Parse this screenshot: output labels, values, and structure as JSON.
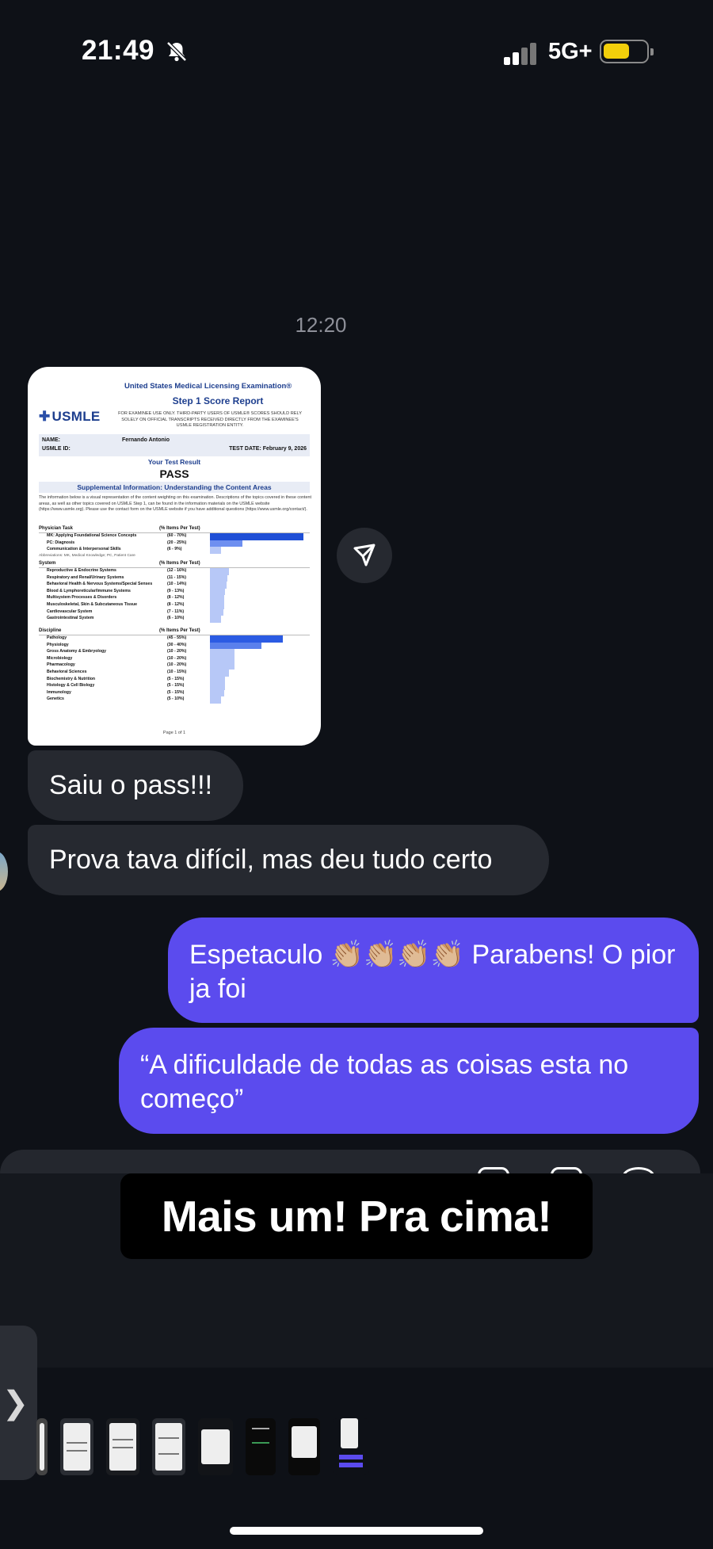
{
  "status_bar": {
    "time": "21:49",
    "network": "5G+",
    "battery_color": "#f2cf0b",
    "bell_icon": "bell-slash-icon"
  },
  "chat": {
    "timestamp": "12:20",
    "doc": {
      "header_line1": "United States Medical Licensing Examination®",
      "header_line2": "Step 1 Score Report",
      "logo": "USMLE",
      "disclaimer": "FOR EXAMINEE USE ONLY. THIRD-PARTY USERS OF USMLE® SCORES SHOULD RELY SOLELY ON OFFICIAL TRANSCRIPTS RECEIVED DIRECTLY FROM THE EXAMINEE'S USMLE REGISTRATION ENTITY.",
      "name_label": "NAME:",
      "name_value": "Fernando Antonio",
      "id_label": "USMLE ID:",
      "test_date": "TEST DATE:  February 9, 2026",
      "result_title": "Your Test Result",
      "result": "PASS",
      "supplemental": "Supplemental Information: Understanding the Content Areas",
      "intro": "The information below is a visual representation of the content weighting on this examination. Descriptions of the topics covered in these content areas, as well as other topics covered on USMLE Step 1, can be found in the information materials on the USMLE website (https://www.usmle.org). Please use the contact form on the USMLE website if you have additional questions (https://www.usmle.org/contact/).",
      "pct_header": "(% Items Per Test)",
      "sections": [
        {
          "title": "Physician Task",
          "rows": [
            {
              "label": "MK: Applying Foundational Science Concepts",
              "range": "(60 - 70%)",
              "level": 1.0,
              "color": "#1f4fd6"
            },
            {
              "label": "PC: Diagnosis",
              "range": "(20 - 25%)",
              "level": 0.35,
              "color": "#6e8ff0"
            },
            {
              "label": "Communication & Interpersonal Skills",
              "range": "(6 - 9%)",
              "level": 0.12,
              "color": "#b7c8f7"
            }
          ],
          "abbr": "Abbreviations: MK, Medical Knowledge; PC, Patient Care"
        },
        {
          "title": "System",
          "rows": [
            {
              "label": "Reproductive & Endocrine Systems",
              "range": "(12 - 16%)",
              "level": 0.2,
              "color": "#b7c8f7"
            },
            {
              "label": "Respiratory and Renal/Urinary Systems",
              "range": "(11 - 15%)",
              "level": 0.19,
              "color": "#b7c8f7"
            },
            {
              "label": "Behavioral Health & Nervous Systems/Special Senses",
              "range": "(10 - 14%)",
              "level": 0.18,
              "color": "#b7c8f7"
            },
            {
              "label": "Blood & Lymphoreticular/Immune Systems",
              "range": "(9 - 13%)",
              "level": 0.16,
              "color": "#b7c8f7"
            },
            {
              "label": "Multisystem Processes & Disorders",
              "range": "(8 - 12%)",
              "level": 0.15,
              "color": "#b7c8f7"
            },
            {
              "label": "Musculoskeletal, Skin & Subcutaneous Tissue",
              "range": "(8 - 12%)",
              "level": 0.15,
              "color": "#b7c8f7"
            },
            {
              "label": "Cardiovascular System",
              "range": "(7 - 11%)",
              "level": 0.14,
              "color": "#b7c8f7"
            },
            {
              "label": "Gastrointestinal System",
              "range": "(6 - 10%)",
              "level": 0.12,
              "color": "#b7c8f7"
            }
          ]
        },
        {
          "title": "Discipline",
          "rows": [
            {
              "label": "Pathology",
              "range": "(45 - 55%)",
              "level": 0.78,
              "color": "#2b5be3"
            },
            {
              "label": "Physiology",
              "range": "(30 - 40%)",
              "level": 0.55,
              "color": "#5a80ec"
            },
            {
              "label": "Gross Anatomy & Embryology",
              "range": "(10 - 20%)",
              "level": 0.26,
              "color": "#b7c8f7"
            },
            {
              "label": "Microbiology",
              "range": "(10 - 20%)",
              "level": 0.26,
              "color": "#b7c8f7"
            },
            {
              "label": "Pharmacology",
              "range": "(10 - 20%)",
              "level": 0.26,
              "color": "#b7c8f7"
            },
            {
              "label": "Behavioral Sciences",
              "range": "(10 - 15%)",
              "level": 0.2,
              "color": "#b7c8f7"
            },
            {
              "label": "Biochemistry & Nutrition",
              "range": "(5 - 15%)",
              "level": 0.16,
              "color": "#b7c8f7"
            },
            {
              "label": "Histology & Cell Biology",
              "range": "(5 - 15%)",
              "level": 0.16,
              "color": "#b7c8f7"
            },
            {
              "label": "Immunology",
              "range": "(5 - 15%)",
              "level": 0.15,
              "color": "#b7c8f7"
            },
            {
              "label": "Genetics",
              "range": "(5 - 10%)",
              "level": 0.12,
              "color": "#b7c8f7"
            }
          ]
        }
      ],
      "page": "Page 1 of 1"
    },
    "messages": {
      "m1": "Saiu o pass!!!",
      "m2": "Prova tava difícil, mas deu tudo certo",
      "m3": "Espetaculo 👏🏼👏🏼👏🏼👏🏼 Parabens! O pior ja foi",
      "m4": "“A dificuldade de todas as coisas esta no começo”"
    }
  },
  "overlay": {
    "caption": "Mais um! Pra cima!",
    "handle": "❯"
  },
  "colors": {
    "incoming_bubble": "#262930",
    "outgoing_bubble": "#5b4bee",
    "background": "#0e1117"
  }
}
